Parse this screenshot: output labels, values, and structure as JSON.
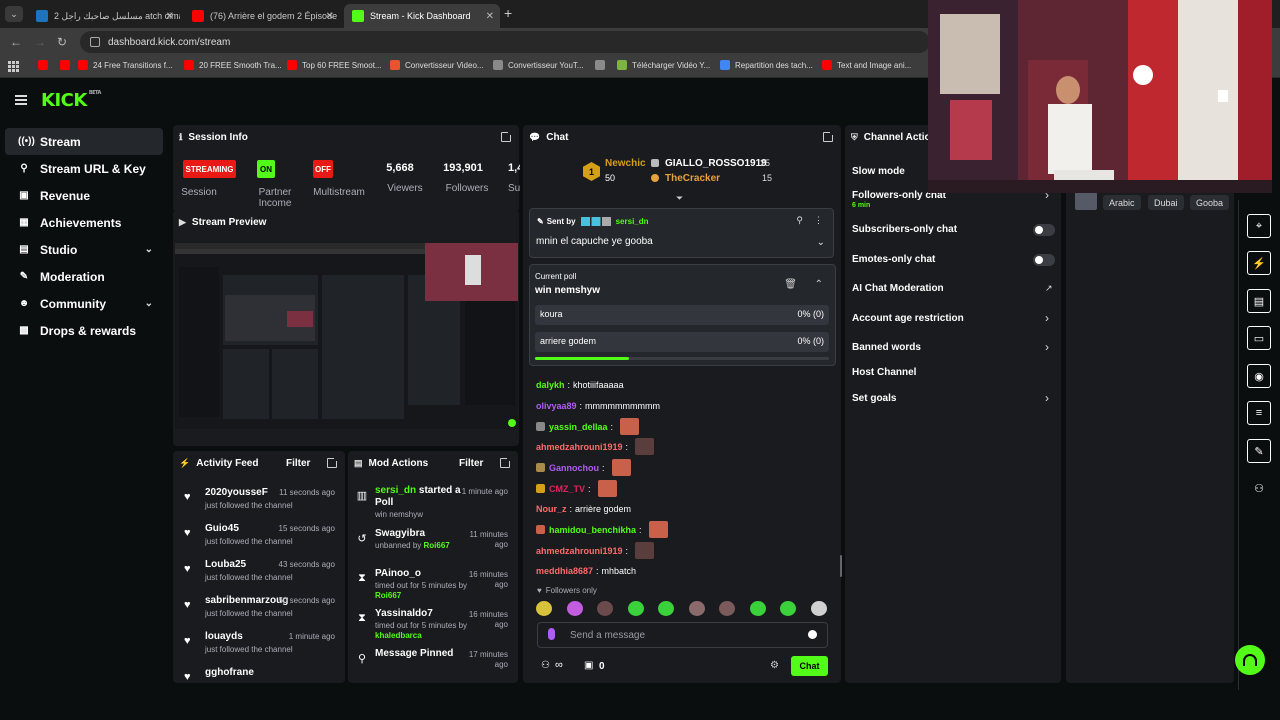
{
  "browser": {
    "tabs": [
      {
        "label": "مسلسل صاحبك راجل 2 atch cima",
        "icon_color": "#1e73be"
      },
      {
        "label": "(76) Arrière el godem 2 Épisode",
        "icon_color": "#ff0000"
      },
      {
        "label": "Stream - Kick Dashboard",
        "icon_color": "#53fc18"
      }
    ],
    "url": "dashboard.kick.com/stream",
    "bookmarks": [
      {
        "label": "",
        "color": "#ff0000"
      },
      {
        "label": "",
        "color": "#ff0000"
      },
      {
        "label": "24 Free Transitions f...",
        "color": "#ff0000"
      },
      {
        "label": "20 FREE Smooth Tra...",
        "color": "#ff0000"
      },
      {
        "label": "Top 60 FREE Smoot...",
        "color": "#ff0000"
      },
      {
        "label": "Convertisseur Video...",
        "color": "#e8542d"
      },
      {
        "label": "Convertisseur YouT...",
        "color": "#8a8a8a"
      },
      {
        "label": "",
        "color": "#8a8a8a"
      },
      {
        "label": "Télécharger Vidéo Y...",
        "color": "#7cb342"
      },
      {
        "label": "Repartition des tach...",
        "color": "#4285f4"
      },
      {
        "label": "Text and Image ani...",
        "color": "#ff0000"
      }
    ]
  },
  "app": {
    "logo": "KICK",
    "logo_tag": "BETA"
  },
  "sidebar": {
    "items": [
      {
        "label": "Stream",
        "icon": "radio-icon",
        "glyph": "((•))",
        "active": true,
        "chevron": false
      },
      {
        "label": "Stream URL & Key",
        "icon": "link-icon",
        "glyph": "⚲",
        "active": false,
        "chevron": false
      },
      {
        "label": "Revenue",
        "icon": "wallet-icon",
        "glyph": "▣",
        "active": false,
        "chevron": false
      },
      {
        "label": "Achievements",
        "icon": "trophy-icon",
        "glyph": "▦",
        "active": false,
        "chevron": false
      },
      {
        "label": "Studio",
        "icon": "layers-icon",
        "glyph": "▤",
        "active": false,
        "chevron": true
      },
      {
        "label": "Moderation",
        "icon": "wrench-icon",
        "glyph": "✎",
        "active": false,
        "chevron": false
      },
      {
        "label": "Community",
        "icon": "users-icon",
        "glyph": "☻",
        "active": false,
        "chevron": true
      },
      {
        "label": "Drops & rewards",
        "icon": "gift-icon",
        "glyph": "▩",
        "active": false,
        "chevron": false
      }
    ]
  },
  "session": {
    "title": "Session Info",
    "streaming_badge": "STREAMING",
    "session_label": "Session",
    "partner_badge": "ON",
    "partner_label": "Partner Income",
    "multistream_badge": "OFF",
    "multistream_label": "Multistream",
    "viewers": "5,668",
    "viewers_label": "Viewers",
    "followers": "193,901",
    "followers_label": "Followers",
    "subs": "1,4",
    "subs_label": "Su"
  },
  "preview": {
    "title": "Stream Preview"
  },
  "activity": {
    "title": "Activity Feed",
    "filter": "Filter",
    "items": [
      {
        "name": "2020yousseF",
        "sub": "just followed the channel",
        "time": "11 seconds ago"
      },
      {
        "name": "Guio45",
        "sub": "just followed the channel",
        "time": "15 seconds ago"
      },
      {
        "name": "Louba25",
        "sub": "just followed the channel",
        "time": "43 seconds ago"
      },
      {
        "name": "sabribenmarzoug",
        "sub": "just followed the channel",
        "time": "50 seconds ago"
      },
      {
        "name": "louayds",
        "sub": "just followed the channel",
        "time": "1 minute ago"
      },
      {
        "name": "gghofrane",
        "sub": "",
        "time": ""
      }
    ]
  },
  "mod_actions": {
    "title": "Mod Actions",
    "filter": "Filter",
    "items": [
      {
        "user": "sersi_dn",
        "action": " started a Poll",
        "sub": "win nemshyw",
        "by": "",
        "time": "1 minute ago",
        "icon": "poll-icon",
        "glyph": "▥"
      },
      {
        "user": "",
        "action": "Swagyibra",
        "sub": "unbanned by ",
        "by": "Roi667",
        "time": "11 minutes ago",
        "icon": "undo-icon",
        "glyph": "↺"
      },
      {
        "user": "",
        "action": "PAinoo_o",
        "sub": "timed out for 5 minutes by ",
        "by": "Roi667",
        "time": "16 minutes ago",
        "icon": "hourglass-icon",
        "glyph": "⧗"
      },
      {
        "user": "",
        "action": "Yassinaldo7",
        "sub": "timed out for 5 minutes by ",
        "by": "khaledbarca",
        "time": "16 minutes ago",
        "icon": "hourglass-icon",
        "glyph": "⧗"
      },
      {
        "user": "",
        "action": "Message Pinned",
        "sub": "",
        "by": "",
        "time": "17 minutes ago",
        "icon": "pin-icon",
        "glyph": "⚲"
      }
    ]
  },
  "chat": {
    "title": "Chat",
    "leaderboard": [
      {
        "rank": "1",
        "name": "Newchic",
        "count": "50"
      },
      {
        "name": "GIALLO_ROSSO1919",
        "count": "25"
      },
      {
        "name": "TheCracker",
        "count": "15"
      }
    ],
    "pinned": {
      "prefix": "Sent by",
      "user": "sersi_dn",
      "text": "mnin el capuche ye gooba"
    },
    "poll": {
      "label": "Current poll",
      "question": "win nemshyw",
      "options": [
        {
          "label": "koura",
          "result": "0% (0)"
        },
        {
          "label": "arriere godem",
          "result": "0% (0)"
        }
      ],
      "progress": 0.32
    },
    "messages": [
      {
        "user": "dalykh",
        "color": "#53fc18",
        "text": "khotiiifaaaaa",
        "emote": "",
        "badge": ""
      },
      {
        "user": "olivyaa89",
        "color": "#b05cf5",
        "text": "mmmmmmmmmm",
        "emote": "",
        "badge": ""
      },
      {
        "user": "yassin_dellaa",
        "color": "#53fc18",
        "text": "",
        "emote": "#c9614a",
        "badge": "#888"
      },
      {
        "user": "ahmedzahrouni1919",
        "color": "#ff6b6b",
        "text": "",
        "emote": "#5a3e3e",
        "badge": ""
      },
      {
        "user": "Gannochou",
        "color": "#b05cf5",
        "text": "",
        "emote": "#c9614a",
        "badge": "#a88a4a"
      },
      {
        "user": "CMZ_TV",
        "color": "#e0245e",
        "text": "",
        "emote": "#c9614a",
        "badge": "#d4a017"
      },
      {
        "user": "Nour_z",
        "color": "#ff6b6b",
        "text": "arrière godem",
        "emote": "",
        "badge": ""
      },
      {
        "user": "hamidou_benchikha",
        "color": "#53fc18",
        "text": "",
        "emote": "#c9614a",
        "badge": "#c9614a"
      },
      {
        "user": "ahmedzahrouni1919",
        "color": "#ff6b6b",
        "text": "",
        "emote": "#5a3e3e",
        "badge": ""
      },
      {
        "user": "meddhia8687",
        "color": "#ff6b6b",
        "text": "mhbatch",
        "emote": "",
        "badge": ""
      }
    ],
    "followers_only": "Followers only",
    "placeholder": "Send a message",
    "points": "0",
    "send_label": "Chat",
    "emote_colors": [
      "#d8c33a",
      "#c35de0",
      "#6a4a4a",
      "#3bd13b",
      "#3bd13b",
      "#8a6a6a",
      "#7a5a5a",
      "#3bd13b",
      "#3bd13b",
      "#d0d0d0"
    ]
  },
  "channel_actions": {
    "title": "Channel Actions",
    "items": [
      {
        "label": "Slow mode",
        "sub": "",
        "kind": "none"
      },
      {
        "label": "Followers-only chat",
        "sub": "6 min",
        "kind": "chevron"
      },
      {
        "label": "Subscribers-only chat",
        "sub": "",
        "kind": "toggle"
      },
      {
        "label": "Emotes-only chat",
        "sub": "",
        "kind": "toggle"
      },
      {
        "label": "AI Chat Moderation",
        "sub": "",
        "kind": "external"
      },
      {
        "label": "Account age restriction",
        "sub": "",
        "kind": "chevron"
      },
      {
        "label": "Banned words",
        "sub": "",
        "kind": "chevron"
      },
      {
        "label": "Host Channel",
        "sub": "",
        "kind": "none"
      },
      {
        "label": "Set goals",
        "sub": "",
        "kind": "chevron"
      }
    ]
  },
  "tags": [
    "Arabic",
    "Dubai",
    "Gooba"
  ],
  "colors": {
    "accent": "#53fc18",
    "streaming": "#e91916",
    "panel": "#191b1f",
    "background": "#0b0e0f"
  }
}
